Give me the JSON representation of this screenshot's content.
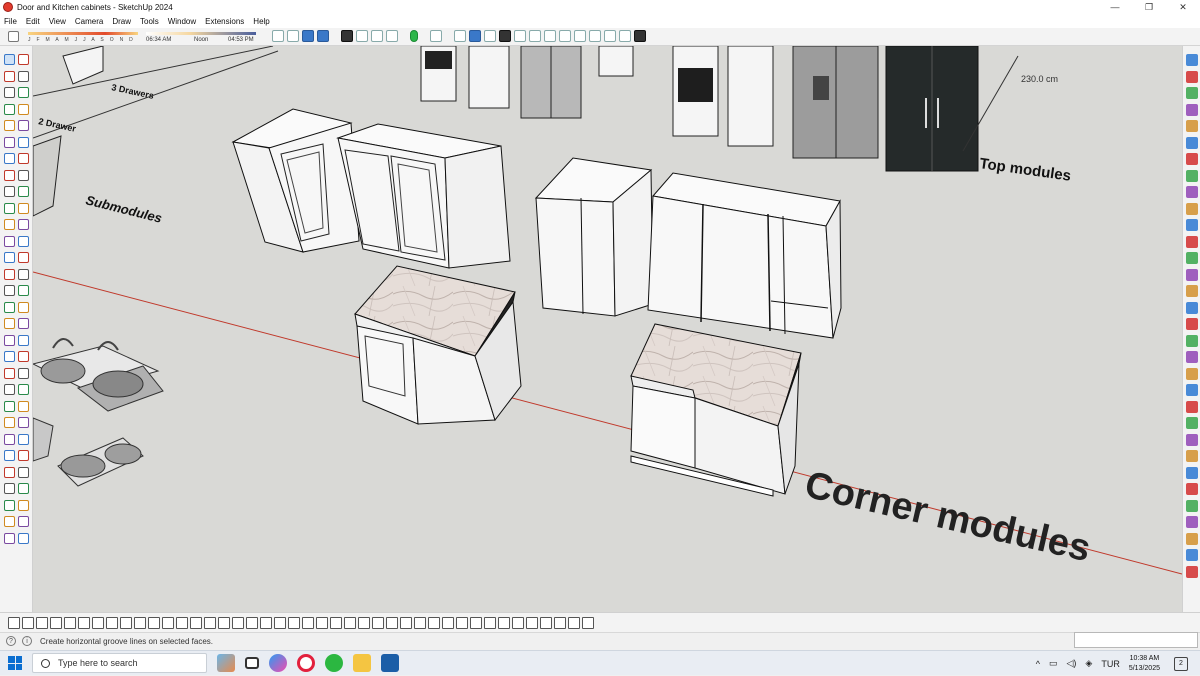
{
  "window": {
    "title": "Door and Kitchen cabinets - SketchUp 2024",
    "controls": [
      "—",
      "❐",
      "✕"
    ]
  },
  "menu": [
    "File",
    "Edit",
    "View",
    "Camera",
    "Draw",
    "Tools",
    "Window",
    "Extensions",
    "Help"
  ],
  "shadow_settings": {
    "months": "J F M A M J J A S O N D",
    "time_start": "06:34 AM",
    "time_mid": "Noon",
    "time_end": "04:53 PM"
  },
  "viewport": {
    "labels": {
      "drawers": "3 Drawers",
      "drawer2": "2 Drawer",
      "submodules": "Submodules",
      "top_modules": "Top modules",
      "corner_modules": "Corner modules",
      "dimension": "230.0 cm"
    }
  },
  "status": {
    "message": "Create horizontal groove lines on selected faces."
  },
  "taskbar": {
    "search_placeholder": "Type here to search",
    "language": "TUR",
    "time": "10:38 AM",
    "date": "5/13/2025",
    "notification_count": "2"
  },
  "colors": {
    "viewport_bg": "#d9d9d6",
    "axis_red": "#c0392b",
    "cabinet_face": "#f7f7f7",
    "edge": "#1a1a1a",
    "marble": "#e4dcd7"
  }
}
